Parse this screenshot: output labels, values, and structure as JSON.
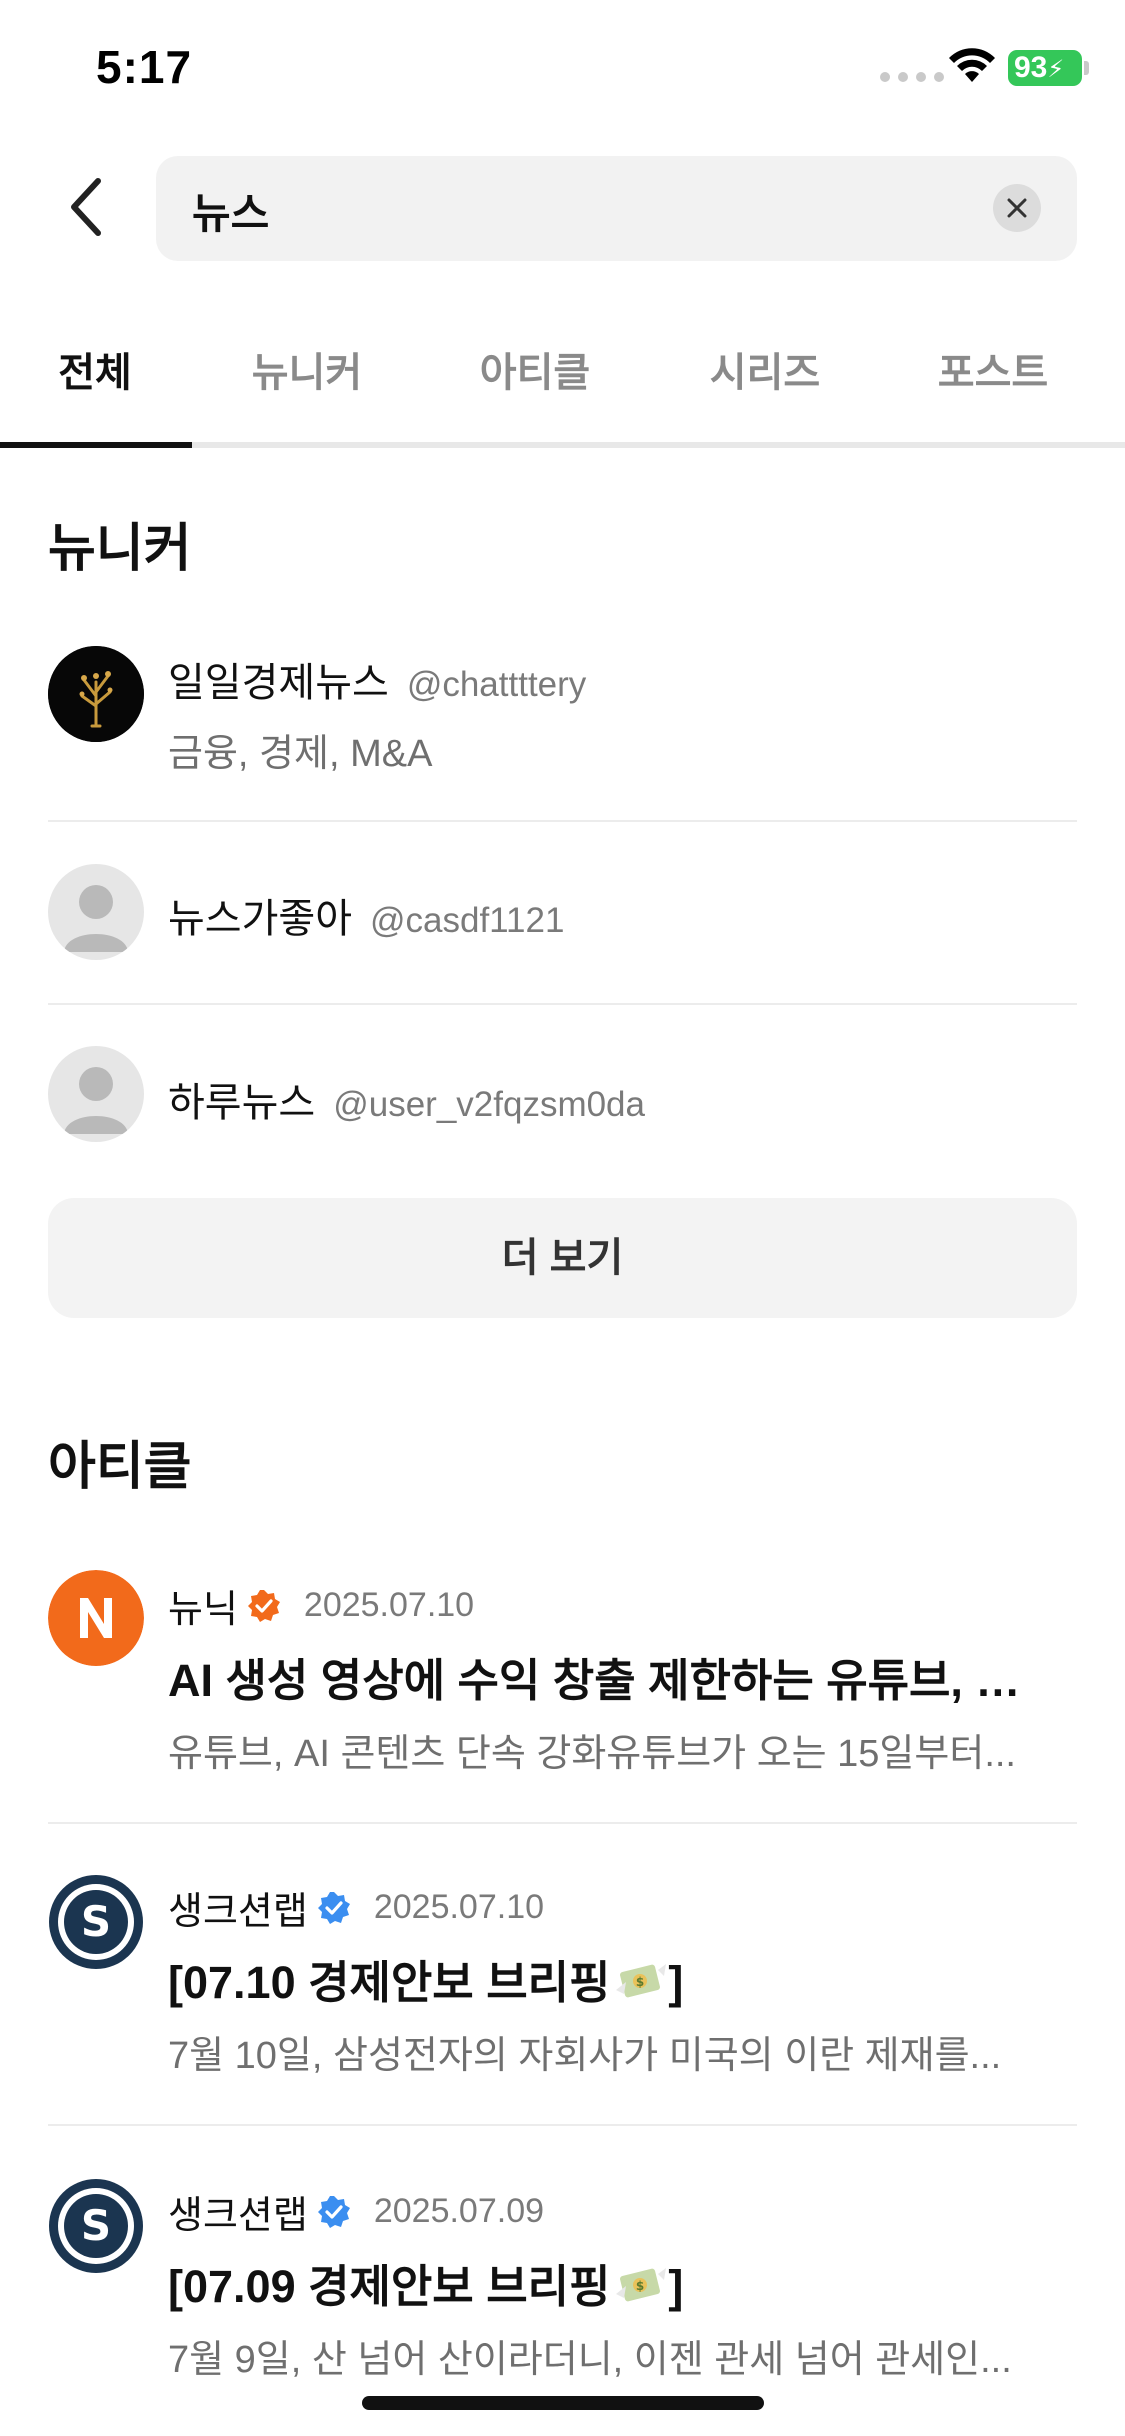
{
  "status_bar": {
    "time": "5:17",
    "battery": "93"
  },
  "search": {
    "query": "뉴스"
  },
  "tabs": [
    {
      "label": "전체",
      "active": true
    },
    {
      "label": "뉴니커",
      "active": false
    },
    {
      "label": "아티클",
      "active": false
    },
    {
      "label": "시리즈",
      "active": false
    },
    {
      "label": "포스트",
      "active": false
    }
  ],
  "users_section": {
    "title": "뉴니커",
    "items": [
      {
        "name": "일일경제뉴스",
        "handle": "@chattttery",
        "desc": "금융, 경제, M&A",
        "avatar": "custom-dark"
      },
      {
        "name": "뉴스가좋아",
        "handle": "@casdf1121",
        "desc": "",
        "avatar": "default"
      },
      {
        "name": "하루뉴스",
        "handle": "@user_v2fqzsm0da",
        "desc": "",
        "avatar": "default"
      }
    ],
    "more_label": "더 보기"
  },
  "articles_section": {
    "title": "아티클",
    "items": [
      {
        "author": "뉴닉",
        "date": "2025.07.10",
        "title": "AI 생성 영상에 수익 창출 제한하는 유튜브, 이...",
        "excerpt": "유튜브, AI 콘텐츠 단속 강화유튜브가 오는 15일부터...",
        "badge_color": "#f06d1a"
      },
      {
        "author": "생크션랩",
        "date": "2025.07.10",
        "title": "[07.10 경제안보 브리핑",
        "title_end": "]",
        "excerpt": "7월 10일, 삼성전자의 자회사가 미국의 이란 제재를...",
        "badge_color": "#3b8ef0"
      },
      {
        "author": "생크션랩",
        "date": "2025.07.09",
        "title": "[07.09 경제안보 브리핑",
        "title_end": "]",
        "excerpt": "7월 9일, 산 넘어 산이라더니, 이젠 관세 넘어 관세인...",
        "badge_color": "#3b8ef0"
      }
    ]
  },
  "icons": {
    "back": "chevron-left-icon",
    "clear": "close-icon",
    "verified": "verified-badge-icon",
    "money": "money-with-wings-icon"
  },
  "colors": {
    "accent": "#111111",
    "newneek_orange": "#f26a1b",
    "battery_green": "#34c759"
  }
}
